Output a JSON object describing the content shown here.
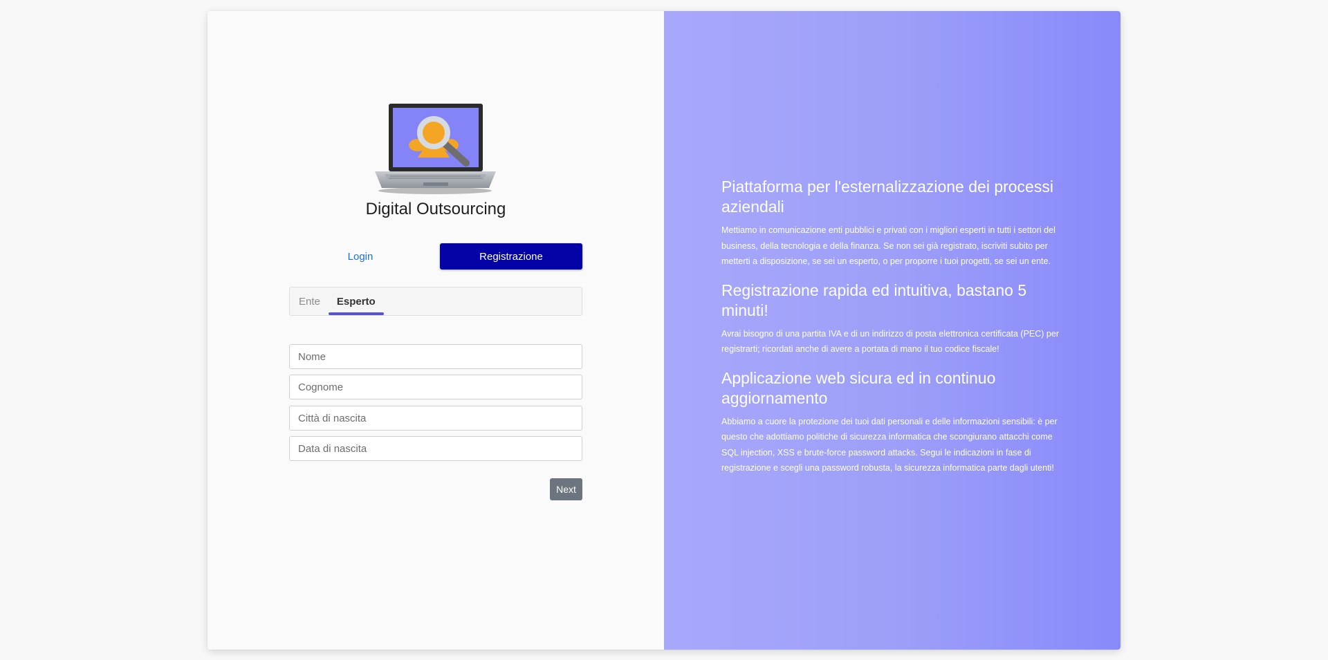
{
  "app": {
    "title": "Digital Outsourcing"
  },
  "auth_tabs": {
    "login": "Login",
    "register": "Registrazione"
  },
  "type_tabs": {
    "ente": "Ente",
    "esperto": "Esperto",
    "active": "Esperto"
  },
  "form": {
    "nome_placeholder": "Nome",
    "cognome_placeholder": "Cognome",
    "citta_placeholder": "Città di nascita",
    "data_placeholder": "Data di nascita",
    "next_label": "Next"
  },
  "info": {
    "sections": [
      {
        "heading": "Piattaforma per l'esternalizzazione dei processi aziendali",
        "body": "Mettiamo in comunicazione enti pubblici e privati con i migliori esperti in tutti i settori del business, della tecnologia e della finanza. Se non sei già registrato, iscriviti subito per metterti a disposizione, se sei un esperto, o per proporre i tuoi progetti, se sei un ente."
      },
      {
        "heading": "Registrazione rapida ed intuitiva, bastano 5 minuti!",
        "body": "Avrai bisogno di una partita IVA e di un indirizzo di posta elettronica certificata (PEC) per registrarti; ricordati anche di avere a portata di mano il tuo codice fiscale!"
      },
      {
        "heading": "Applicazione web sicura ed in continuo aggiornamento",
        "body": "Abbiamo a cuore la protezione dei tuoi dati personali e delle informazioni sensibili: è per questo che adottiamo politiche di sicurezza informatica che scongiurano attacchi come SQL injection, XSS e brute-force password attacks. Segui le indicazioni in fase di registrazione e scegli una password robusta, la sicurezza informatica parte dagli utenti!"
      }
    ]
  },
  "colors": {
    "primary": "#0404a6",
    "link": "#1a6fd8",
    "tab_indicator": "#5854c7",
    "panel_gradient_start": "#a8a8fb",
    "panel_gradient_end": "#8989fb",
    "next_button": "#6c757d"
  },
  "icons": {
    "logo": "laptop-magnifier-icon"
  }
}
